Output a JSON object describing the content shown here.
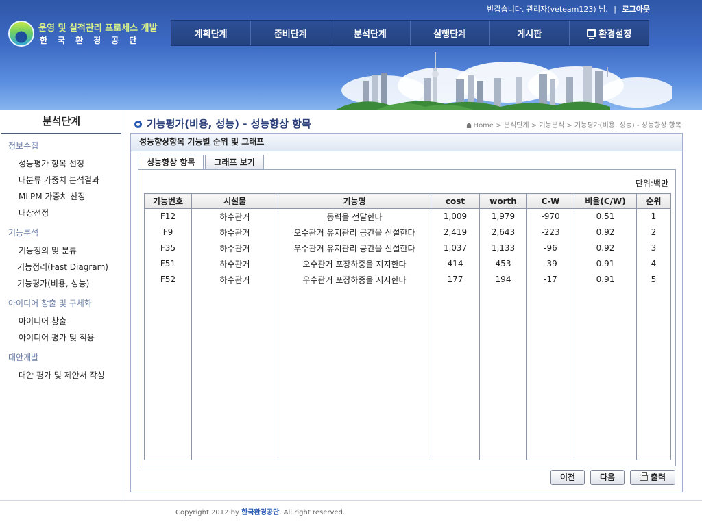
{
  "header": {
    "greeting": "반갑습니다. 관리자(veteam123) 님.",
    "separator": "|",
    "logout": "로그아웃",
    "logo_line1": "운영 및 실적관리 프로세스 개발",
    "logo_line2": "한국환경공단"
  },
  "nav": [
    {
      "label": "계획단계"
    },
    {
      "label": "준비단계"
    },
    {
      "label": "분석단계"
    },
    {
      "label": "실행단계"
    },
    {
      "label": "게시판"
    },
    {
      "label": "환경설정",
      "icon": "pc-icon"
    }
  ],
  "sidebar": {
    "title": "분석단계",
    "groups": [
      {
        "label": "정보수집",
        "items": [
          "성능평가 항목 선정",
          "대분류 가중치 분석결과",
          "MLPM 가중치 산정",
          "대상선정"
        ]
      },
      {
        "label": "기능분석",
        "items": [
          "기능정의 및 분류",
          "기능정리(Fast Diagram)",
          "기능평가(비용, 성능)"
        ]
      },
      {
        "label": "아이디어 창출 및 구체화",
        "items": [
          "아이디어 창출",
          "아이디어 평가 및 적용"
        ]
      },
      {
        "label": "대안개발",
        "items": [
          "대안 평가 및 제안서 작성"
        ]
      }
    ]
  },
  "page": {
    "title": "기능평가(비용, 성능) - 성능향상 항목",
    "breadcrumb": "Home > 분석단계 > 기능분석 > 기능평가(비용, 성능) - 성능향상 항목"
  },
  "panel": {
    "title": "성능향상항목 기능별 순위 및 그래프",
    "tabs": [
      "성능향상 항목",
      "그래프 보기"
    ],
    "active_tab": 0,
    "unit": "단위:백만"
  },
  "table": {
    "columns": [
      "기능번호",
      "시설물",
      "기능명",
      "cost",
      "worth",
      "C-W",
      "비율(C/W)",
      "순위"
    ],
    "rows": [
      [
        "F12",
        "하수관거",
        "동력을 전달한다",
        "1,009",
        "1,979",
        "-970",
        "0.51",
        "1"
      ],
      [
        "F9",
        "하수관거",
        "오수관거 유지관리 공간을 신설한다",
        "2,419",
        "2,643",
        "-223",
        "0.92",
        "2"
      ],
      [
        "F35",
        "하수관거",
        "우수관거 유지관리 공간을 신설한다",
        "1,037",
        "1,133",
        "-96",
        "0.92",
        "3"
      ],
      [
        "F51",
        "하수관거",
        "오수관거 포장하중을 지지한다",
        "414",
        "453",
        "-39",
        "0.91",
        "4"
      ],
      [
        "F52",
        "하수관거",
        "우수관거 포장하중을 지지한다",
        "177",
        "194",
        "-17",
        "0.91",
        "5"
      ]
    ]
  },
  "buttons": {
    "prev": "이전",
    "next": "다음",
    "print": "출력"
  },
  "footer": {
    "prefix": "Copyright 2012 by",
    "org": "한국환경공단",
    "suffix": ". All right reserved."
  },
  "colors": {
    "header_top": "#2f57a8",
    "header_bottom": "#86b4ee",
    "nav_bg": "#23427f",
    "title": "#2a3f7a"
  }
}
